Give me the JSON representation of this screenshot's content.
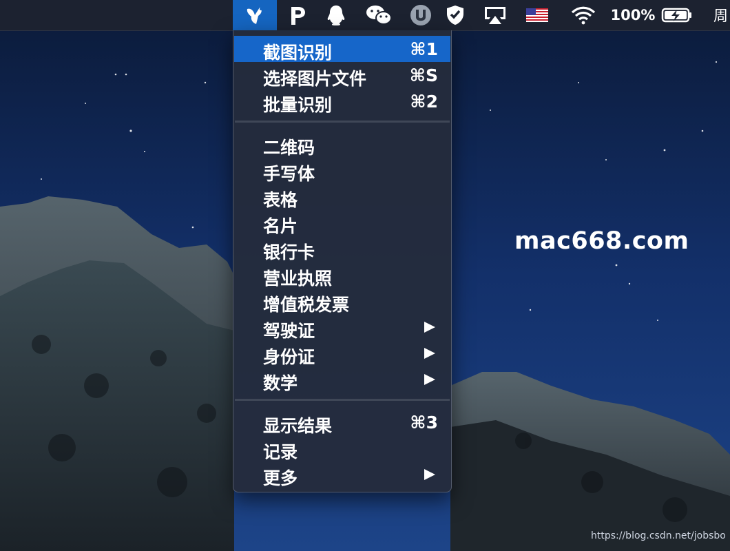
{
  "menubar": {
    "app_icon": "scissors-icon",
    "p_icon": "p-icon",
    "qq_icon": "qq-penguin-icon",
    "wechat_icon": "wechat-icon",
    "u_icon": "u-circle-icon",
    "shield_icon": "shield-check-icon",
    "airplay_icon": "airplay-icon",
    "flag_icon": "us-flag-icon",
    "wifi_icon": "wifi-icon",
    "battery_percent": "100%",
    "battery_icon": "battery-charging-icon",
    "clock_truncated": "周",
    "highlight_color": "#1565c0"
  },
  "menu": {
    "sections": [
      {
        "items": [
          {
            "label": "截图识别",
            "shortcut": "⌘1"
          },
          {
            "label": "选择图片文件",
            "shortcut": "⌘S"
          },
          {
            "label": "批量识别",
            "shortcut": "⌘2"
          }
        ]
      },
      {
        "items": [
          {
            "label": "二维码"
          },
          {
            "label": "手写体"
          },
          {
            "label": "表格"
          },
          {
            "label": "名片"
          },
          {
            "label": "银行卡"
          },
          {
            "label": "营业执照"
          },
          {
            "label": "增值税发票"
          },
          {
            "label": "驾驶证",
            "submenu": true
          },
          {
            "label": "身份证",
            "submenu": true
          },
          {
            "label": "数学",
            "submenu": true
          }
        ]
      },
      {
        "items": [
          {
            "label": "显示结果",
            "shortcut": "⌘3"
          },
          {
            "label": "记录"
          },
          {
            "label": "更多",
            "submenu": true
          }
        ]
      }
    ],
    "highlighted_item": "截图识别"
  },
  "desktop": {
    "watermark": "mac668.com",
    "credit_url": "https://blog.csdn.net/jobsbo"
  }
}
